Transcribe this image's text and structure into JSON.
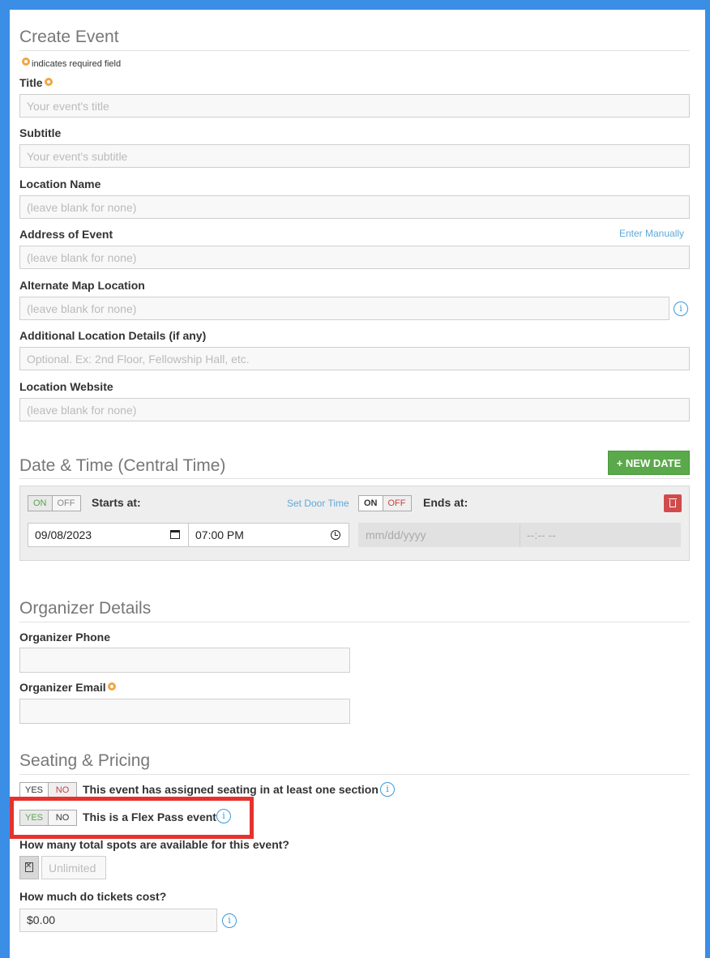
{
  "create_event": {
    "title": "Create Event",
    "required_note": "indicates required field",
    "fields": {
      "title": {
        "label": "Title",
        "placeholder": "Your event's title"
      },
      "subtitle": {
        "label": "Subtitle",
        "placeholder": "Your event's subtitle"
      },
      "location_name": {
        "label": "Location Name",
        "placeholder": "(leave blank for none)"
      },
      "address": {
        "label": "Address of Event",
        "placeholder": "(leave blank for none)",
        "link": "Enter Manually"
      },
      "alt_map": {
        "label": "Alternate Map Location",
        "placeholder": "(leave blank for none)"
      },
      "additional_details": {
        "label": "Additional Location Details (if any)",
        "placeholder": "Optional. Ex: 2nd Floor, Fellowship Hall, etc."
      },
      "location_website": {
        "label": "Location Website",
        "placeholder": "(leave blank for none)"
      }
    }
  },
  "date_time": {
    "title": "Date & Time (Central Time)",
    "new_date_label": "+ NEW DATE",
    "start_toggle": {
      "on": "ON",
      "off": "OFF"
    },
    "starts_at_label": "Starts at:",
    "set_door_time": "Set Door Time",
    "end_toggle": {
      "on": "ON",
      "off": "OFF"
    },
    "ends_at_label": "Ends at:",
    "start_date": "09/08/2023",
    "start_time": "07:00 PM",
    "end_date_placeholder": "mm/dd/yyyy",
    "end_time_placeholder": "--:-- --"
  },
  "organizer": {
    "title": "Organizer Details",
    "phone_label": "Organizer Phone",
    "email_label": "Organizer Email"
  },
  "seating": {
    "title": "Seating & Pricing",
    "assigned_seating": {
      "yes": "YES",
      "no": "NO",
      "label": "This event has assigned seating in at least one section"
    },
    "flex_pass": {
      "yes": "YES",
      "no": "NO",
      "label": "This is a Flex Pass event"
    },
    "spots_label": "How many total spots are available for this event?",
    "spots_placeholder": "Unlimited",
    "cost_label": "How much do tickets cost?",
    "cost_value": "$0.00"
  },
  "colors": {
    "background": "#3a8ee6",
    "accent_green": "#5aa94a",
    "info_blue": "#3a9ad9",
    "required_orange": "#f0a645",
    "highlight_red": "#e5322d"
  }
}
